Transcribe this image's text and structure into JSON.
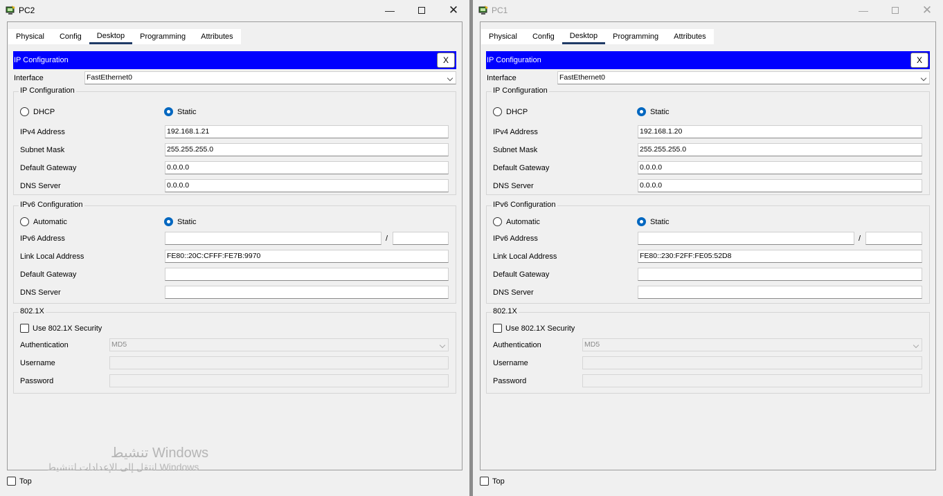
{
  "windows": [
    {
      "title": "PC2",
      "tabs": [
        "Physical",
        "Config",
        "Desktop",
        "Programming",
        "Attributes"
      ],
      "active_tab": "Desktop",
      "header": "IP Configuration",
      "close_label": "X",
      "interface_label": "Interface",
      "interface_value": "FastEthernet0",
      "ipv4_section": "IP Configuration",
      "dhcp_label": "DHCP",
      "static_label": "Static",
      "ipv4_address_label": "IPv4 Address",
      "ipv4_address": "192.168.1.21",
      "subnet_label": "Subnet Mask",
      "subnet_mask": "255.255.255.0",
      "gateway_label": "Default Gateway",
      "gateway": "0.0.0.0",
      "dns_label": "DNS Server",
      "dns": "0.0.0.0",
      "ipv6_section": "IPv6 Configuration",
      "auto_label": "Automatic",
      "static6_label": "Static",
      "ipv6_address_label": "IPv6 Address",
      "ipv6_address": "",
      "slash": "/",
      "prefix": "",
      "link_local_label": "Link Local Address",
      "link_local": "FE80::20C:CFFF:FE7B:9970",
      "gateway6_label": "Default Gateway",
      "gateway6": "",
      "dns6_label": "DNS Server",
      "dns6": "",
      "dot1x_section": "802.1X",
      "use_security_label": "Use 802.1X Security",
      "auth_label": "Authentication",
      "auth_value": "MD5",
      "username_label": "Username",
      "username": "",
      "password_label": "Password",
      "password": "",
      "top_label": "Top"
    },
    {
      "title": "PC1",
      "tabs": [
        "Physical",
        "Config",
        "Desktop",
        "Programming",
        "Attributes"
      ],
      "active_tab": "Desktop",
      "header": "IP Configuration",
      "close_label": "X",
      "interface_label": "Interface",
      "interface_value": "FastEthernet0",
      "ipv4_section": "IP Configuration",
      "dhcp_label": "DHCP",
      "static_label": "Static",
      "ipv4_address_label": "IPv4 Address",
      "ipv4_address": "192.168.1.20",
      "subnet_label": "Subnet Mask",
      "subnet_mask": "255.255.255.0",
      "gateway_label": "Default Gateway",
      "gateway": "0.0.0.0",
      "dns_label": "DNS Server",
      "dns": "0.0.0.0",
      "ipv6_section": "IPv6 Configuration",
      "auto_label": "Automatic",
      "static6_label": "Static",
      "ipv6_address_label": "IPv6 Address",
      "ipv6_address": "",
      "slash": "/",
      "prefix": "",
      "link_local_label": "Link Local Address",
      "link_local": "FE80::230:F2FF:FE05:52D8",
      "gateway6_label": "Default Gateway",
      "gateway6": "",
      "dns6_label": "DNS Server",
      "dns6": "",
      "dot1x_section": "802.1X",
      "use_security_label": "Use 802.1X Security",
      "auth_label": "Authentication",
      "auth_value": "MD5",
      "username_label": "Username",
      "username": "",
      "password_label": "Password",
      "password": "",
      "top_label": "Top"
    }
  ],
  "watermark": {
    "line1": "تنشيط Windows",
    "line2": "انتقل إلى الإعدادات لتنشيط Windows"
  },
  "colors": {
    "header_blue": "#0000ff",
    "radio_blue": "#0067c0",
    "active_tab_underline": "#1f3a66"
  }
}
